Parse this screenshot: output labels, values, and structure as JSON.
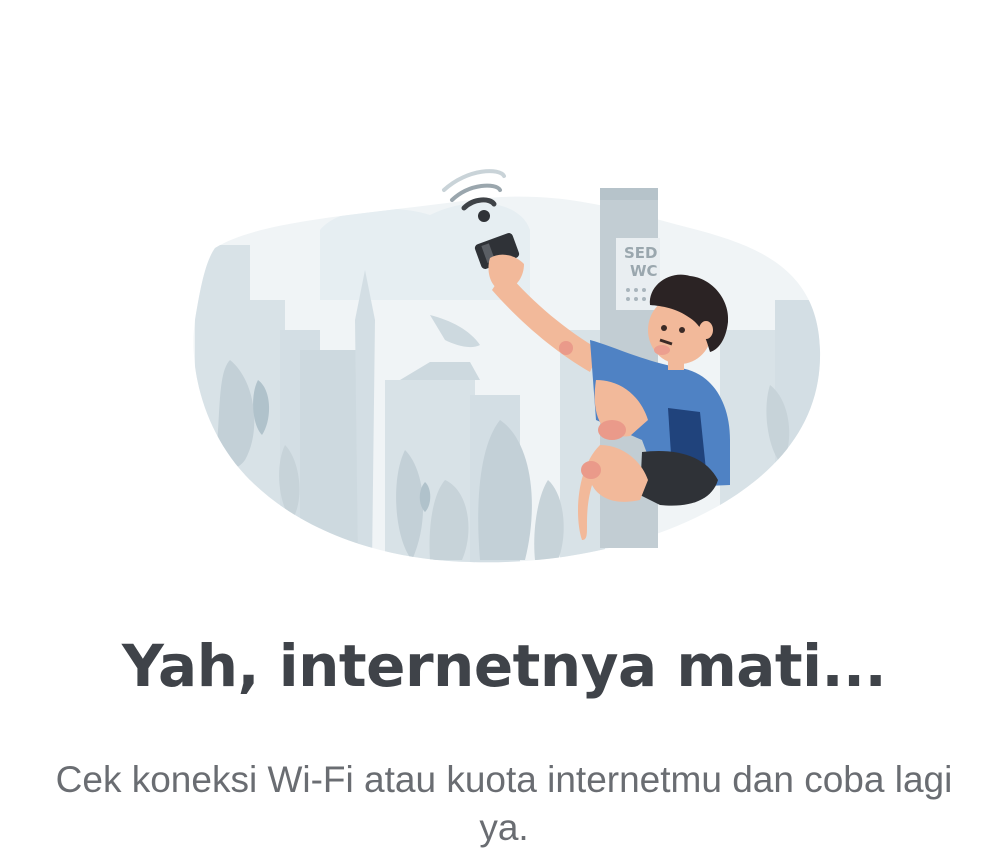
{
  "illustration": {
    "icon": "boy-climbing-pole-for-signal-illustration",
    "sign_text_line1": "SED",
    "sign_text_line2": "WC",
    "colors": {
      "backdrop": "#dfe7eb",
      "shirt": "#4f82c4",
      "pole": "#c2cdd3",
      "skin": "#f2b99a"
    }
  },
  "message": {
    "title": "Yah, internetnya mati...",
    "subtitle": "Cek koneksi Wi-Fi atau kuota internetmu dan coba lagi ya."
  }
}
